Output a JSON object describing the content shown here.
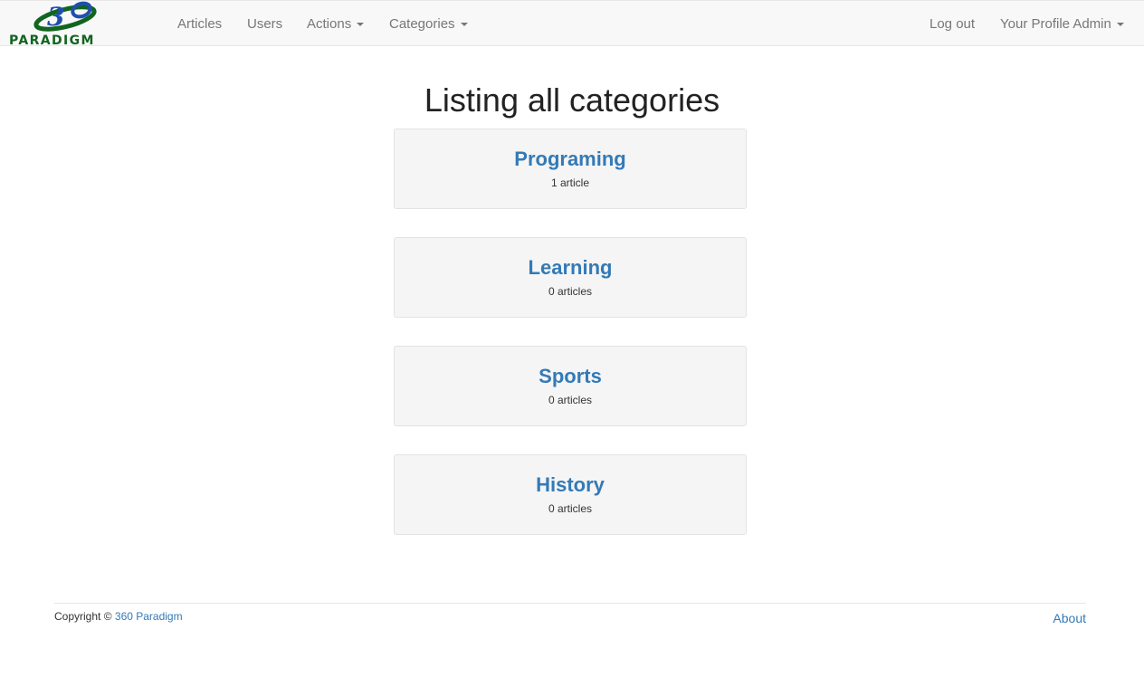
{
  "navbar": {
    "brand": {
      "logo_numeral": "3",
      "logo_text": "PARADIGM",
      "logo_colors": {
        "green": "#11651f",
        "blue": "#1f4fae"
      }
    },
    "left_items": [
      {
        "label": "Articles"
      },
      {
        "label": "Users"
      },
      {
        "label": "Actions",
        "has_caret": true
      },
      {
        "label": "Categories",
        "has_caret": true
      }
    ],
    "right_items": [
      {
        "label": "Log out"
      },
      {
        "label": "Your Profile Admin",
        "has_caret": true
      }
    ]
  },
  "main": {
    "title": "Listing all categories",
    "categories": [
      {
        "name": "Programing",
        "count": "1 article"
      },
      {
        "name": "Learning",
        "count": "0 articles"
      },
      {
        "name": "Sports",
        "count": "0 articles"
      },
      {
        "name": "History",
        "count": "0 articles"
      }
    ]
  },
  "footer": {
    "copyright_prefix": "Copyright ©",
    "company_link": "360 Paradigm",
    "about_link": "About"
  },
  "colors": {
    "link": "#337ab7",
    "nav_text": "#777777",
    "navbar_bg": "#f8f8f8",
    "card_bg": "#f5f5f5"
  }
}
